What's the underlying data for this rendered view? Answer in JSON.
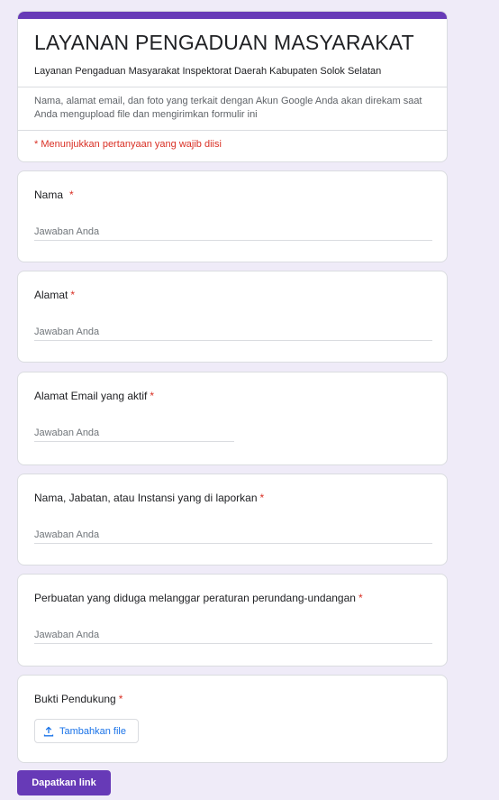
{
  "header": {
    "title": "LAYANAN PENGADUAN MASYARAKAT",
    "description": "Layanan Pengaduan Masyarakat Inspektorat Daerah Kabupaten Solok Selatan",
    "account_notice": "Nama, alamat email, dan foto yang terkait dengan Akun Google Anda akan direkam saat Anda mengupload file dan mengirimkan formulir ini",
    "required_notice": "* Menunjukkan pertanyaan yang wajib diisi",
    "accent_color": "#673ab7"
  },
  "questions": [
    {
      "label": "Nama",
      "required_mark": "*",
      "placeholder": "Jawaban Anda"
    },
    {
      "label": "Alamat",
      "required_mark": "*",
      "placeholder": "Jawaban Anda"
    },
    {
      "label": "Alamat Email yang aktif",
      "required_mark": "*",
      "placeholder": "Jawaban Anda"
    },
    {
      "label": "Nama, Jabatan, atau Instansi yang di laporkan",
      "required_mark": "*",
      "placeholder": "Jawaban Anda"
    },
    {
      "label": "Perbuatan yang diduga melanggar peraturan perundang-undangan",
      "required_mark": "*",
      "placeholder": "Jawaban Anda"
    }
  ],
  "upload_question": {
    "label": "Bukti Pendukung",
    "required_mark": "*",
    "button_label": "Tambahkan file",
    "icon": "upload-icon"
  },
  "submit": {
    "label": "Dapatkan link"
  },
  "colors": {
    "background": "#efebf8",
    "primary": "#673ab7",
    "required": "#d93025",
    "link": "#1a73e8"
  }
}
